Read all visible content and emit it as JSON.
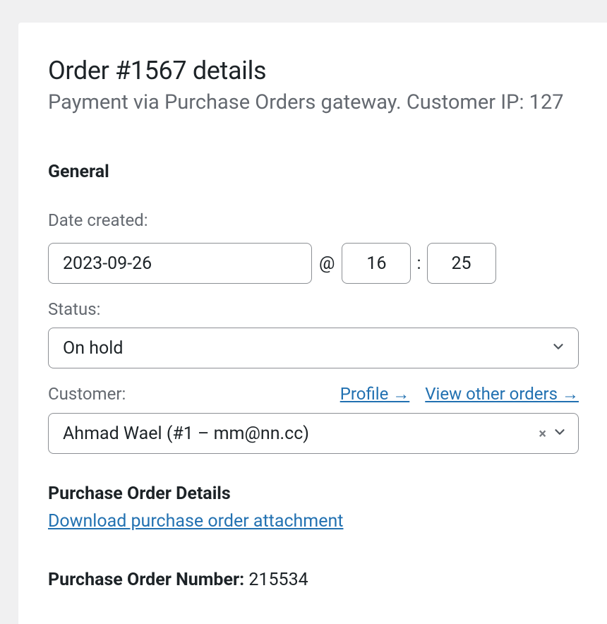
{
  "order": {
    "title": "Order #1567 details",
    "subtitle": "Payment via Purchase Orders gateway. Customer IP: 127"
  },
  "general": {
    "heading": "General",
    "date_created_label": "Date created:",
    "date_value": "2023-09-26",
    "at_symbol": "@",
    "hour_value": "16",
    "colon": ":",
    "minute_value": "25",
    "status_label": "Status:",
    "status_value": "On hold",
    "customer_label": "Customer:",
    "profile_link": "Profile →",
    "other_orders_link": "View other orders →",
    "customer_value": "Ahmad Wael (#1 – mm@nn.cc)"
  },
  "po": {
    "heading": "Purchase Order Details",
    "download_link": "Download purchase order attachment",
    "number_label": "Purchase Order Number:",
    "number_value": "215534"
  }
}
